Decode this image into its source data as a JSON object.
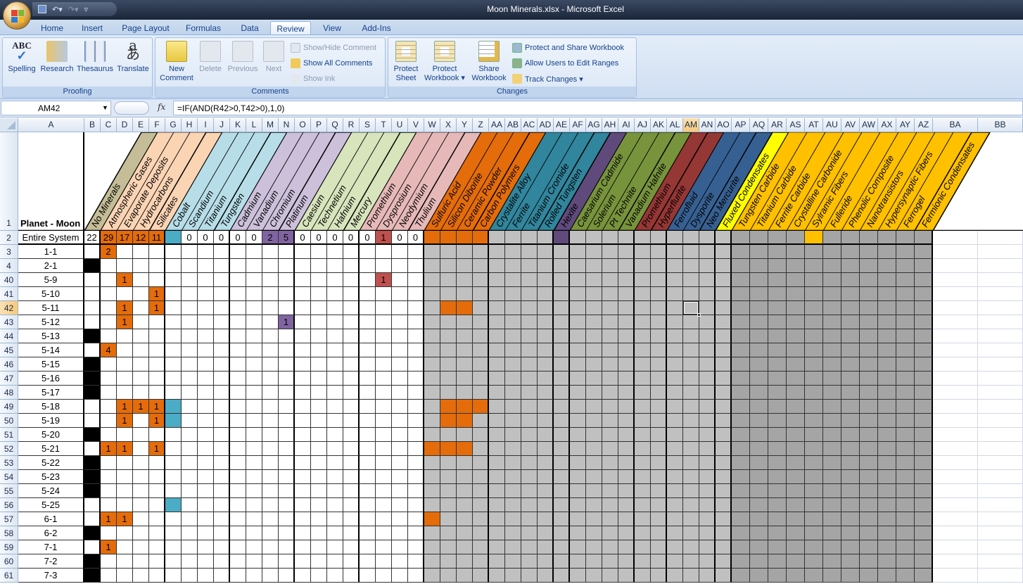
{
  "window": {
    "title": "Moon Minerals.xlsx - Microsoft Excel"
  },
  "quick_access": {
    "save": "save-icon",
    "undo": "undo-icon",
    "redo": "redo-icon",
    "customize": "▿"
  },
  "tabs": [
    {
      "label": "Home",
      "active": false
    },
    {
      "label": "Insert",
      "active": false
    },
    {
      "label": "Page Layout",
      "active": false
    },
    {
      "label": "Formulas",
      "active": false
    },
    {
      "label": "Data",
      "active": false
    },
    {
      "label": "Review",
      "active": true
    },
    {
      "label": "View",
      "active": false
    },
    {
      "label": "Add-Ins",
      "active": false
    }
  ],
  "ribbon": {
    "proofing": {
      "label": "Proofing",
      "spelling": "Spelling",
      "research": "Research",
      "thesaurus": "Thesaurus",
      "translate": "Translate",
      "abc": "ABC"
    },
    "comments": {
      "label": "Comments",
      "new_line1": "New",
      "new_line2": "Comment",
      "delete": "Delete",
      "previous": "Previous",
      "next": "Next",
      "show_hide": "Show/Hide Comment",
      "show_all": "Show All Comments",
      "show_ink": "Show Ink"
    },
    "changes": {
      "label": "Changes",
      "protect_sheet_1": "Protect",
      "protect_sheet_2": "Sheet",
      "protect_wb_1": "Protect",
      "protect_wb_2": "Workbook ▾",
      "share_1": "Share",
      "share_2": "Workbook",
      "protect_share": "Protect and Share Workbook",
      "allow_users": "Allow Users to Edit Ranges",
      "track": "Track Changes ▾"
    }
  },
  "formula_bar": {
    "name_box": "AM42",
    "fx": "fx",
    "formula": "=IF(AND(R42>0,T42>0),1,0)"
  },
  "colors": {
    "tan": "#c4bd97",
    "peach": "#fbd4b4",
    "lightblue": "#b7dee8",
    "lavender": "#ccc0da",
    "lightgreen": "#d7e4bc",
    "pink": "#e6b9b8",
    "orange": "#e46c0a",
    "teal": "#31859c",
    "purple": "#604a7b",
    "olive": "#77933c",
    "darkred": "#953735",
    "darkblue": "#376092",
    "yellow": "#ffff00",
    "gold": "#ffc000",
    "cyan": "#4bacc6",
    "violet": "#8064a2",
    "red": "#c0504d",
    "lightgray": "#c0c0c0",
    "gray": "#a5a5a5",
    "black": "#000000"
  },
  "sheet": {
    "columns": [
      "A",
      "B",
      "C",
      "D",
      "E",
      "F",
      "G",
      "H",
      "I",
      "J",
      "K",
      "L",
      "M",
      "N",
      "O",
      "P",
      "Q",
      "R",
      "S",
      "T",
      "U",
      "V",
      "W",
      "X",
      "Y",
      "Z",
      "AA",
      "AB",
      "AC",
      "AD",
      "AE",
      "AF",
      "AG",
      "AH",
      "AI",
      "AJ",
      "AK",
      "AL",
      "AM",
      "AN",
      "AO",
      "AP",
      "AQ",
      "AR",
      "AS",
      "AT",
      "AU",
      "AV",
      "AW",
      "AX",
      "AY",
      "AZ",
      "BA",
      "BB"
    ],
    "selected_cell": "AM42",
    "header_label": "Planet - Moon",
    "minerals": [
      {
        "col": "B",
        "name": "No Minerals",
        "color": "tan"
      },
      {
        "col": "C",
        "name": "Atmospheric Gases",
        "color": "peach"
      },
      {
        "col": "D",
        "name": "Evaporate Deposits",
        "color": "peach"
      },
      {
        "col": "E",
        "name": "Hydrocarbons",
        "color": "peach"
      },
      {
        "col": "F",
        "name": "Silicates",
        "color": "peach"
      },
      {
        "col": "G",
        "name": "Cobalt",
        "color": "lightblue"
      },
      {
        "col": "H",
        "name": "Scandium",
        "color": "lightblue"
      },
      {
        "col": "I",
        "name": "Titanium",
        "color": "lightblue"
      },
      {
        "col": "J",
        "name": "Tungsten",
        "color": "lightblue"
      },
      {
        "col": "K",
        "name": "Cadmium",
        "color": "lavender"
      },
      {
        "col": "L",
        "name": "Vanadium",
        "color": "lavender"
      },
      {
        "col": "M",
        "name": "Chromium",
        "color": "lavender"
      },
      {
        "col": "N",
        "name": "Platinum",
        "color": "lavender"
      },
      {
        "col": "O",
        "name": "Caesium",
        "color": "lightgreen"
      },
      {
        "col": "P",
        "name": "Technetium",
        "color": "lightgreen"
      },
      {
        "col": "Q",
        "name": "Hafnium",
        "color": "lightgreen"
      },
      {
        "col": "R",
        "name": "Mercury",
        "color": "lightgreen"
      },
      {
        "col": "S",
        "name": "Promethium",
        "color": "pink"
      },
      {
        "col": "T",
        "name": "Dysprosium",
        "color": "pink"
      },
      {
        "col": "U",
        "name": "Neodymium",
        "color": "pink"
      },
      {
        "col": "V",
        "name": "Thulium",
        "color": "pink"
      },
      {
        "col": "W",
        "name": "Sulfuric Acid",
        "color": "orange"
      },
      {
        "col": "X",
        "name": "Silicon Diborite",
        "color": "orange"
      },
      {
        "col": "Y",
        "name": "Ceramic Powder",
        "color": "orange"
      },
      {
        "col": "Z",
        "name": "Carbon Polymers",
        "color": "orange"
      },
      {
        "col": "AA",
        "name": "Crystalite Alloy",
        "color": "teal"
      },
      {
        "col": "AB",
        "name": "Ferrite",
        "color": "teal"
      },
      {
        "col": "AC",
        "name": "Titanium Cromide",
        "color": "teal"
      },
      {
        "col": "AD",
        "name": "Rolled Tungsten",
        "color": "teal"
      },
      {
        "col": "AE",
        "name": "Hexite",
        "color": "purple"
      },
      {
        "col": "AF",
        "name": "Caesarium Cadmide",
        "color": "olive"
      },
      {
        "col": "AG",
        "name": "Solerium",
        "color": "olive"
      },
      {
        "col": "AH",
        "name": "Pt Technite",
        "color": "olive"
      },
      {
        "col": "AI",
        "name": "Vanadium Hafnite",
        "color": "olive"
      },
      {
        "col": "AJ",
        "name": "Promethium",
        "color": "darkred"
      },
      {
        "col": "AK",
        "name": "Hyperflurite",
        "color": "darkred"
      },
      {
        "col": "AL",
        "name": "Ferrofluid",
        "color": "darkblue"
      },
      {
        "col": "AM",
        "name": "Dysporite",
        "color": "darkblue"
      },
      {
        "col": "AN",
        "name": "Neo Mercurite",
        "color": "darkblue"
      },
      {
        "col": "AO",
        "name": "Fluxed Condensates",
        "color": "yellow"
      },
      {
        "col": "AP",
        "name": "Tungsten Carbide",
        "color": "gold"
      },
      {
        "col": "AQ",
        "name": "Titanium Carbide",
        "color": "gold"
      },
      {
        "col": "AR",
        "name": "Ferrite Carbide",
        "color": "gold"
      },
      {
        "col": "AS",
        "name": "Crystalline Carbonide",
        "color": "gold"
      },
      {
        "col": "AT",
        "name": "Sylramic Fibers",
        "color": "gold"
      },
      {
        "col": "AU",
        "name": "Fulleride",
        "color": "gold"
      },
      {
        "col": "AV",
        "name": "Phenolic Composite",
        "color": "gold"
      },
      {
        "col": "AW",
        "name": "Nanotransistors",
        "color": "gold"
      },
      {
        "col": "AX",
        "name": "Hypersynaptic Fibers",
        "color": "gold"
      },
      {
        "col": "AY",
        "name": "Ferrogel",
        "color": "gold"
      },
      {
        "col": "AZ",
        "name": "Fermionic Condensates",
        "color": "gold"
      }
    ],
    "rows": [
      {
        "num": "2",
        "label": "Entire System",
        "values": {
          "B": "22",
          "C": "29",
          "D": "17",
          "E": "12",
          "F": "11",
          "H": "0",
          "I": "0",
          "J": "0",
          "K": "0",
          "L": "0",
          "M": "2",
          "N": "5",
          "O": "0",
          "P": "0",
          "Q": "0",
          "R": "0",
          "S": "0",
          "T": "1",
          "U": "0",
          "V": "0"
        },
        "fills": {
          "C": "orange",
          "D": "orange",
          "E": "orange",
          "F": "orange",
          "G": "cyan",
          "M": "violet",
          "N": "violet",
          "T": "red",
          "W": "orange",
          "X": "orange",
          "Y": "orange",
          "Z": "orange",
          "AE": "purple",
          "AT": "gold"
        }
      },
      {
        "num": "3",
        "label": "1-1",
        "values": {
          "C": "2"
        },
        "fills": {
          "C": "orange"
        }
      },
      {
        "num": "4",
        "label": "2-1",
        "values": {},
        "fills": {
          "B": "black"
        }
      },
      {
        "num": "40",
        "label": "5-9",
        "values": {
          "D": "1",
          "T": "1"
        },
        "fills": {
          "D": "orange",
          "T": "red"
        }
      },
      {
        "num": "41",
        "label": "5-10",
        "values": {
          "F": "1"
        },
        "fills": {
          "F": "orange"
        }
      },
      {
        "num": "42",
        "label": "5-11",
        "values": {
          "D": "1",
          "F": "1"
        },
        "fills": {
          "D": "orange",
          "F": "orange",
          "X": "orange",
          "Y": "orange"
        }
      },
      {
        "num": "43",
        "label": "5-12",
        "values": {
          "D": "1",
          "N": "1"
        },
        "fills": {
          "D": "orange",
          "N": "violet"
        }
      },
      {
        "num": "44",
        "label": "5-13",
        "values": {},
        "fills": {
          "B": "black"
        }
      },
      {
        "num": "45",
        "label": "5-14",
        "values": {
          "C": "4"
        },
        "fills": {
          "C": "orange"
        }
      },
      {
        "num": "46",
        "label": "5-15",
        "values": {},
        "fills": {
          "B": "black"
        }
      },
      {
        "num": "47",
        "label": "5-16",
        "values": {},
        "fills": {
          "B": "black"
        }
      },
      {
        "num": "48",
        "label": "5-17",
        "values": {},
        "fills": {
          "B": "black"
        }
      },
      {
        "num": "49",
        "label": "5-18",
        "values": {
          "D": "1",
          "E": "1",
          "F": "1"
        },
        "fills": {
          "D": "orange",
          "E": "orange",
          "F": "orange",
          "G": "cyan",
          "X": "orange",
          "Y": "orange",
          "Z": "orange"
        }
      },
      {
        "num": "50",
        "label": "5-19",
        "values": {
          "D": "1",
          "F": "1"
        },
        "fills": {
          "D": "orange",
          "F": "orange",
          "G": "cyan",
          "X": "orange",
          "Y": "orange"
        }
      },
      {
        "num": "51",
        "label": "5-20",
        "values": {},
        "fills": {
          "B": "black"
        }
      },
      {
        "num": "52",
        "label": "5-21",
        "values": {
          "C": "1",
          "D": "1",
          "F": "1"
        },
        "fills": {
          "C": "orange",
          "D": "orange",
          "F": "orange",
          "W": "orange",
          "X": "orange",
          "Y": "orange"
        }
      },
      {
        "num": "53",
        "label": "5-22",
        "values": {},
        "fills": {
          "B": "black"
        }
      },
      {
        "num": "54",
        "label": "5-23",
        "values": {},
        "fills": {
          "B": "black"
        }
      },
      {
        "num": "55",
        "label": "5-24",
        "values": {},
        "fills": {
          "B": "black"
        }
      },
      {
        "num": "56",
        "label": "5-25",
        "values": {},
        "fills": {
          "G": "cyan"
        }
      },
      {
        "num": "57",
        "label": "6-1",
        "values": {
          "C": "1",
          "D": "1"
        },
        "fills": {
          "C": "orange",
          "D": "orange",
          "W": "orange"
        }
      },
      {
        "num": "58",
        "label": "6-2",
        "values": {},
        "fills": {
          "B": "black"
        }
      },
      {
        "num": "59",
        "label": "7-1",
        "values": {
          "C": "1"
        },
        "fills": {
          "C": "orange"
        }
      },
      {
        "num": "60",
        "label": "7-2",
        "values": {},
        "fills": {
          "B": "black"
        }
      },
      {
        "num": "61",
        "label": "7-3",
        "values": {},
        "fills": {
          "B": "black"
        }
      }
    ]
  }
}
